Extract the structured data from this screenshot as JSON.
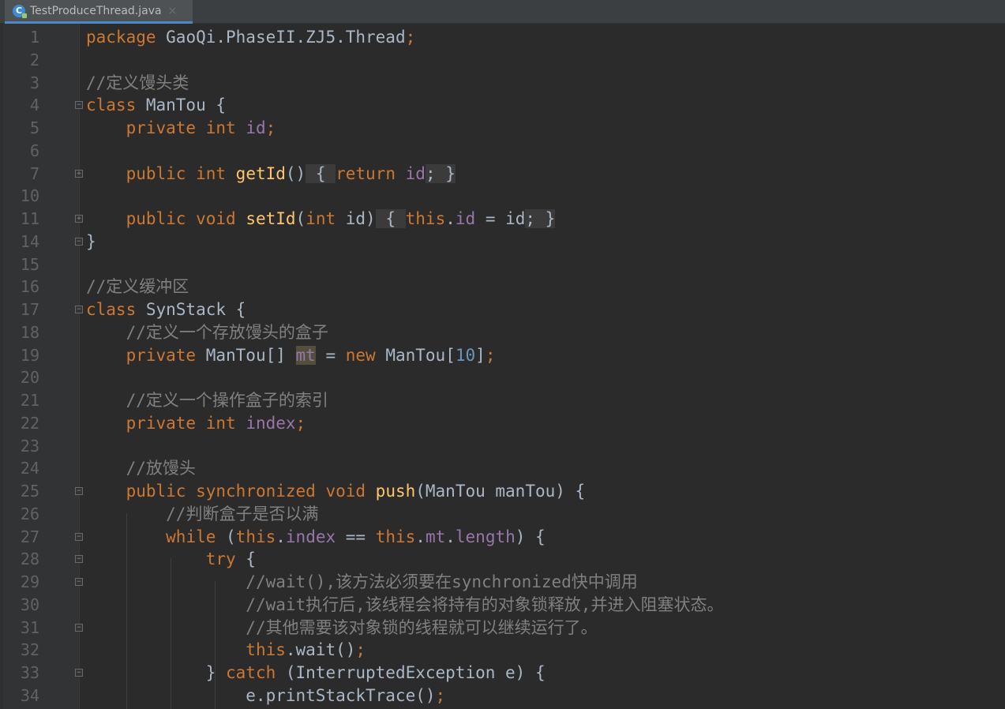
{
  "tab": {
    "filename": "TestProduceThread.java",
    "icon": "c-class-icon",
    "close": "×"
  },
  "code_lines": [
    {
      "n": "1",
      "tokens": [
        [
          "kw",
          "package"
        ],
        [
          "p",
          " GaoQi.PhaseII.ZJ5.Thread"
        ],
        [
          "kw",
          ";"
        ]
      ]
    },
    {
      "n": "2",
      "tokens": []
    },
    {
      "n": "3",
      "tokens": [
        [
          "cm",
          "//定义馒头类"
        ]
      ]
    },
    {
      "n": "4",
      "fold": "open",
      "tokens": [
        [
          "kw",
          "class"
        ],
        [
          "p",
          " ManTou {"
        ]
      ]
    },
    {
      "n": "5",
      "tokens": [
        [
          "p",
          "    "
        ],
        [
          "kw",
          "private int"
        ],
        [
          "p",
          " "
        ],
        [
          "fld",
          "id"
        ],
        [
          "kw",
          ";"
        ]
      ]
    },
    {
      "n": "6",
      "tokens": []
    },
    {
      "n": "7",
      "fold": "closed",
      "tokens": [
        [
          "p",
          "    "
        ],
        [
          "kw",
          "public int"
        ],
        [
          "p",
          " "
        ],
        [
          "fn",
          "getId"
        ],
        [
          "p",
          "()"
        ],
        [
          "fb",
          " { "
        ],
        [
          "kw",
          "return"
        ],
        [
          "p",
          " "
        ],
        [
          "fld",
          "id"
        ],
        [
          "fb",
          "; }"
        ]
      ]
    },
    {
      "n": "10",
      "tokens": []
    },
    {
      "n": "11",
      "fold": "closed",
      "tokens": [
        [
          "p",
          "    "
        ],
        [
          "kw",
          "public void"
        ],
        [
          "p",
          " "
        ],
        [
          "fn",
          "setId"
        ],
        [
          "p",
          "("
        ],
        [
          "kw",
          "int"
        ],
        [
          "p",
          " id)"
        ],
        [
          "fb",
          " { "
        ],
        [
          "kw",
          "this"
        ],
        [
          "p",
          "."
        ],
        [
          "fld",
          "id"
        ],
        [
          "p",
          " = id"
        ],
        [
          "fb",
          "; }"
        ]
      ]
    },
    {
      "n": "14",
      "fold": "end",
      "tokens": [
        [
          "p",
          "}"
        ]
      ]
    },
    {
      "n": "15",
      "tokens": []
    },
    {
      "n": "16",
      "tokens": [
        [
          "cm",
          "//定义缓冲区"
        ]
      ]
    },
    {
      "n": "17",
      "fold": "open",
      "tokens": [
        [
          "kw",
          "class"
        ],
        [
          "p",
          " SynStack {"
        ]
      ]
    },
    {
      "n": "18",
      "tokens": [
        [
          "p",
          "    "
        ],
        [
          "cm",
          "//定义一个存放馒头的盒子"
        ]
      ]
    },
    {
      "n": "19",
      "tokens": [
        [
          "p",
          "    "
        ],
        [
          "kw",
          "private"
        ],
        [
          "p",
          " ManTou[] "
        ],
        [
          "hl",
          "mt"
        ],
        [
          "p",
          " = "
        ],
        [
          "kw",
          "new"
        ],
        [
          "p",
          " ManTou["
        ],
        [
          "num",
          "10"
        ],
        [
          "p",
          "]"
        ],
        [
          "kw",
          ";"
        ]
      ]
    },
    {
      "n": "20",
      "tokens": []
    },
    {
      "n": "21",
      "tokens": [
        [
          "p",
          "    "
        ],
        [
          "cm",
          "//定义一个操作盒子的索引"
        ]
      ]
    },
    {
      "n": "22",
      "tokens": [
        [
          "p",
          "    "
        ],
        [
          "kw",
          "private int"
        ],
        [
          "p",
          " "
        ],
        [
          "fld",
          "index"
        ],
        [
          "kw",
          ";"
        ]
      ]
    },
    {
      "n": "23",
      "tokens": []
    },
    {
      "n": "24",
      "tokens": [
        [
          "p",
          "    "
        ],
        [
          "cm",
          "//放馒头"
        ]
      ]
    },
    {
      "n": "25",
      "fold": "open",
      "tokens": [
        [
          "p",
          "    "
        ],
        [
          "kw",
          "public synchronized void"
        ],
        [
          "p",
          " "
        ],
        [
          "fn",
          "push"
        ],
        [
          "p",
          "(ManTou manTou) {"
        ]
      ]
    },
    {
      "n": "26",
      "tokens": [
        [
          "p",
          "        "
        ],
        [
          "cm",
          "//判断盒子是否以满"
        ]
      ]
    },
    {
      "n": "27",
      "fold": "open",
      "tokens": [
        [
          "p",
          "        "
        ],
        [
          "kw",
          "while"
        ],
        [
          "p",
          " ("
        ],
        [
          "kw",
          "this"
        ],
        [
          "p",
          "."
        ],
        [
          "fld",
          "index"
        ],
        [
          "p",
          " == "
        ],
        [
          "kw",
          "this"
        ],
        [
          "p",
          "."
        ],
        [
          "fld",
          "mt"
        ],
        [
          "p",
          "."
        ],
        [
          "fld",
          "length"
        ],
        [
          "p",
          ") {"
        ]
      ]
    },
    {
      "n": "28",
      "fold": "open",
      "tokens": [
        [
          "p",
          "            "
        ],
        [
          "kw",
          "try"
        ],
        [
          "p",
          " {"
        ]
      ]
    },
    {
      "n": "29",
      "fold": "open",
      "tokens": [
        [
          "p",
          "                "
        ],
        [
          "cm",
          "//wait(),该方法必须要在synchronized快中调用"
        ]
      ]
    },
    {
      "n": "30",
      "tokens": [
        [
          "p",
          "                "
        ],
        [
          "cm",
          "//wait执行后,该线程会将持有的对象锁释放,并进入阻塞状态。"
        ]
      ]
    },
    {
      "n": "31",
      "fold": "end",
      "tokens": [
        [
          "p",
          "                "
        ],
        [
          "cm",
          "//其他需要该对象锁的线程就可以继续运行了。"
        ]
      ]
    },
    {
      "n": "32",
      "tokens": [
        [
          "p",
          "                "
        ],
        [
          "kw",
          "this"
        ],
        [
          "p",
          ".wait()"
        ],
        [
          "kw",
          ";"
        ]
      ]
    },
    {
      "n": "33",
      "fold": "open",
      "tokens": [
        [
          "p",
          "            } "
        ],
        [
          "kw",
          "catch"
        ],
        [
          "p",
          " (InterruptedException e) {"
        ]
      ]
    },
    {
      "n": "34",
      "tokens": [
        [
          "p",
          "                e.printStackTrace()"
        ],
        [
          "kw",
          ";"
        ]
      ]
    }
  ]
}
